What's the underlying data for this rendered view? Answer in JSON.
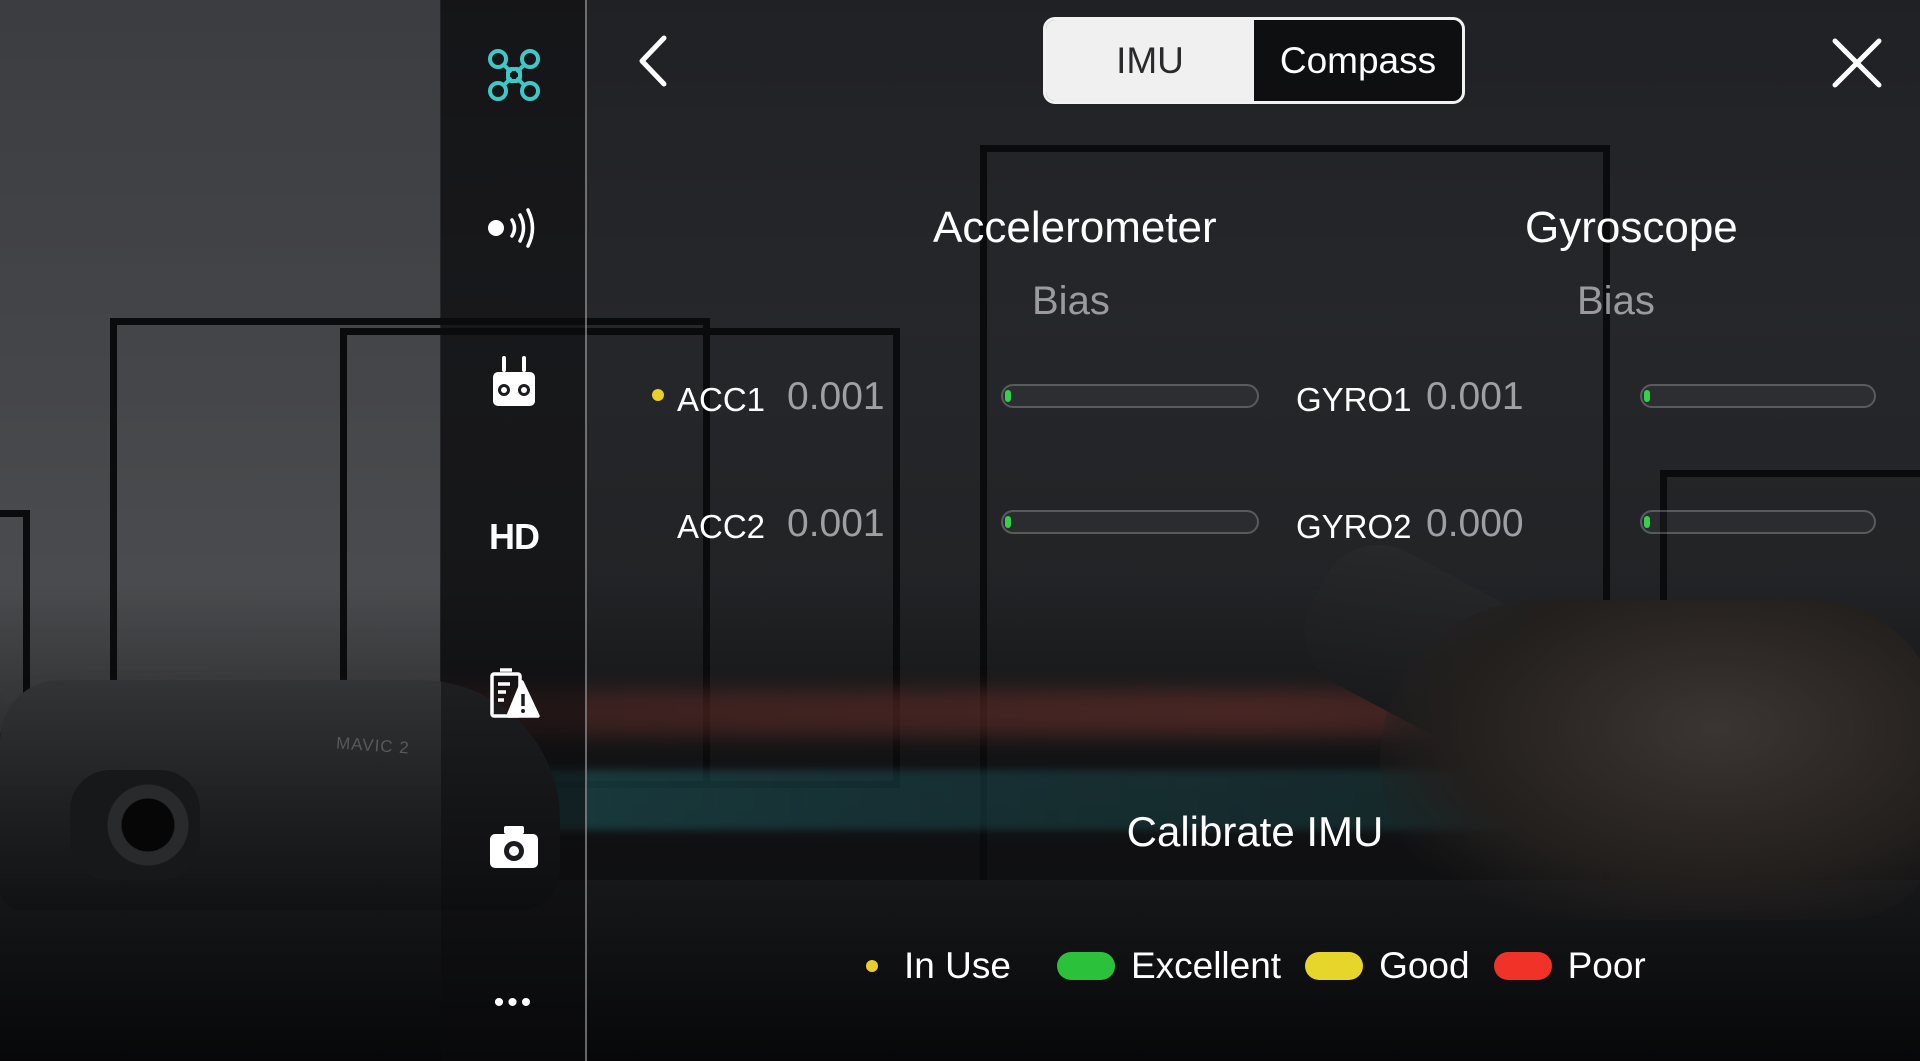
{
  "colors": {
    "accent_teal": "#3ec8c6",
    "in_use": "#e8cf2a",
    "excellent": "#2bc13a",
    "good": "#e6d52b",
    "poor": "#f03228",
    "bar_fill": "#32d34a"
  },
  "sidebar": {
    "items": [
      {
        "icon": "aircraft-icon",
        "active": true
      },
      {
        "icon": "signal-icon",
        "active": false
      },
      {
        "icon": "remote-controller-icon",
        "active": false
      },
      {
        "icon": "hd-icon",
        "label": "HD",
        "active": false
      },
      {
        "icon": "battery-alert-icon",
        "active": false
      },
      {
        "icon": "camera-icon",
        "active": false
      },
      {
        "icon": "more-icon",
        "label": "•••",
        "active": false
      }
    ]
  },
  "header": {
    "back_icon": "back-chevron-icon",
    "close_icon": "close-icon",
    "tabs": [
      {
        "label": "IMU",
        "selected": true
      },
      {
        "label": "Compass",
        "selected": false
      }
    ]
  },
  "accelerometer": {
    "title": "Accelerometer",
    "subtitle": "Bias",
    "sensors": [
      {
        "name": "ACC1",
        "value": "0.001",
        "in_use": true,
        "bias_fraction": 0.001
      },
      {
        "name": "ACC2",
        "value": "0.001",
        "in_use": false,
        "bias_fraction": 0.001
      }
    ]
  },
  "gyroscope": {
    "title": "Gyroscope",
    "subtitle": "Bias",
    "sensors": [
      {
        "name": "GYRO1",
        "value": "0.001",
        "in_use": false,
        "bias_fraction": 0.001
      },
      {
        "name": "GYRO2",
        "value": "0.000",
        "in_use": false,
        "bias_fraction": 0.0
      }
    ]
  },
  "calibrate": {
    "label": "Calibrate IMU"
  },
  "legend": [
    {
      "label": "In Use",
      "kind": "dot",
      "color": "#e8cf2a"
    },
    {
      "label": "Excellent",
      "kind": "pill",
      "color": "#2bc13a"
    },
    {
      "label": "Good",
      "kind": "pill",
      "color": "#e6d52b"
    },
    {
      "label": "Poor",
      "kind": "pill",
      "color": "#f03228"
    }
  ],
  "background": {
    "drone_label": "MAVIC 2"
  }
}
